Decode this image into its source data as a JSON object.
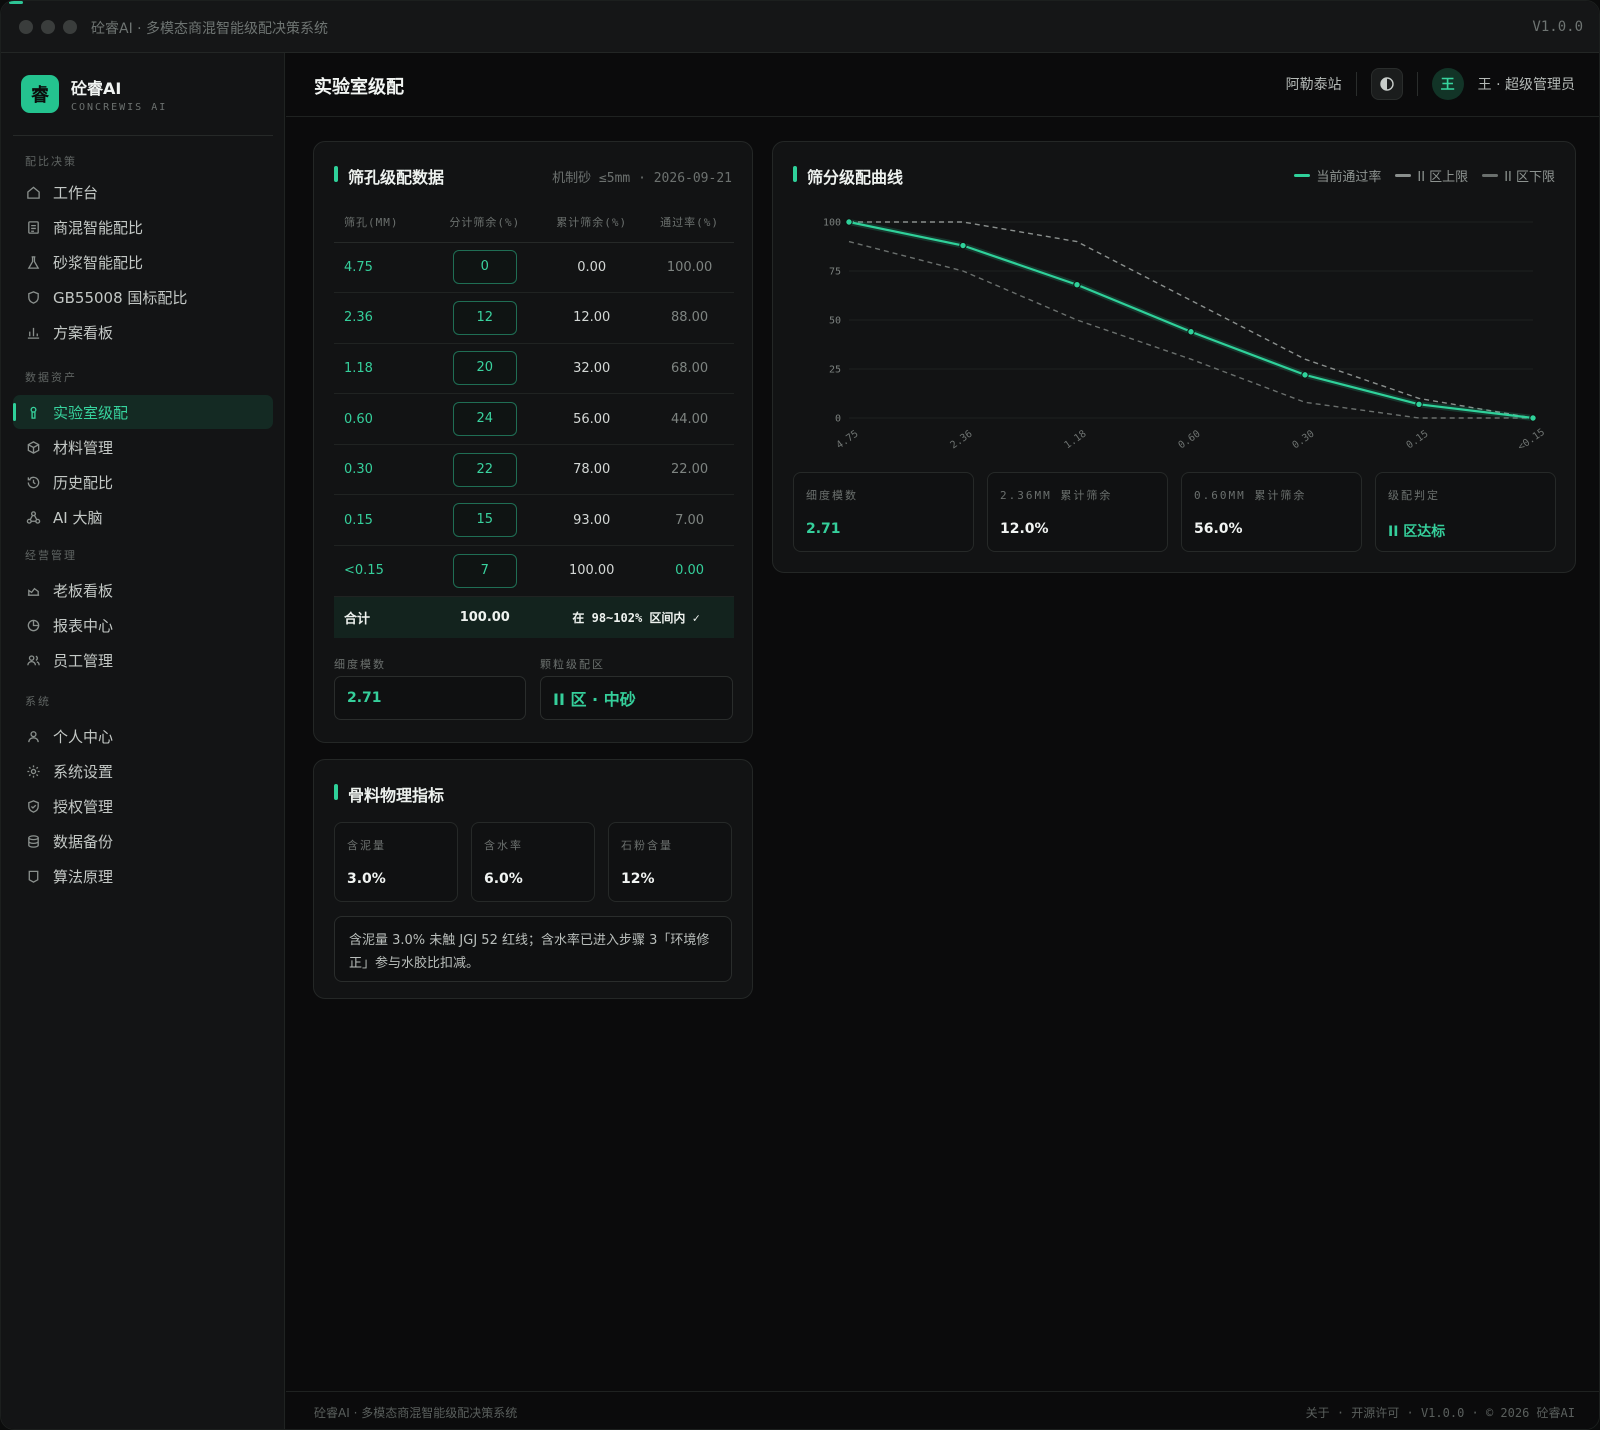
{
  "titlebar": {
    "title": "砼睿AI · 多模态商混智能级配决策系统",
    "version": "V1.0.0"
  },
  "brand": {
    "logo": "睿",
    "name": "砼睿AI",
    "sub": "CONCREWIS AI"
  },
  "nav": {
    "s1": "配比决策",
    "i1": "工作台",
    "i2": "商混智能配比",
    "i3": "砂浆智能配比",
    "i4": "GB55008 国标配比",
    "i5": "方案看板",
    "s2": "数据资产",
    "i6": "实验室级配",
    "i7": "材料管理",
    "i8": "历史配比",
    "i9": "AI 大脑",
    "s3": "经营管理",
    "i10": "老板看板",
    "i11": "报表中心",
    "i12": "员工管理",
    "s4": "系统",
    "i13": "个人中心",
    "i14": "系统设置",
    "i15": "授权管理",
    "i16": "数据备份",
    "i17": "算法原理"
  },
  "header": {
    "title": "实验室级配",
    "station": "阿勒泰站",
    "avatar": "王",
    "user": "王 · 超级管理员"
  },
  "sieve_card": {
    "title": "筛孔级配数据",
    "meta": "机制砂 ≤5mm · 2026-09-21",
    "columns": [
      "筛孔(MM)",
      "分计筛余(%)",
      "累计筛余(%)",
      "通过率(%)"
    ],
    "rows": [
      {
        "sieve": "4.75",
        "retained": "0",
        "cumulative": "0.00",
        "passing": "100.00"
      },
      {
        "sieve": "2.36",
        "retained": "12",
        "cumulative": "12.00",
        "passing": "88.00"
      },
      {
        "sieve": "1.18",
        "retained": "20",
        "cumulative": "32.00",
        "passing": "68.00"
      },
      {
        "sieve": "0.60",
        "retained": "24",
        "cumulative": "56.00",
        "passing": "44.00"
      },
      {
        "sieve": "0.30",
        "retained": "22",
        "cumulative": "78.00",
        "passing": "22.00"
      },
      {
        "sieve": "0.15",
        "retained": "15",
        "cumulative": "93.00",
        "passing": "7.00"
      },
      {
        "sieve": "<0.15",
        "retained": "7",
        "cumulative": "100.00",
        "passing": "0.00"
      }
    ],
    "total_label": "合计",
    "total_value": "100.00",
    "total_status": "在 98~102% 区间内 ✓",
    "fineness_label": "细度模数",
    "fineness_value": "2.71",
    "zone_label": "颗粒级配区",
    "zone_value": "II 区 · 中砂"
  },
  "phys_card": {
    "title": "骨料物理指标",
    "kpis": [
      {
        "label": "含泥量",
        "value": "3.0%"
      },
      {
        "label": "含水率",
        "value": "6.0%"
      },
      {
        "label": "石粉含量",
        "value": "12%"
      }
    ],
    "note": "含泥量 3.0% 未触 JGJ 52 红线；含水率已进入步骤 3「环境修正」参与水胶比扣减。"
  },
  "curve_card": {
    "title": "筛分级配曲线",
    "kpis": [
      {
        "label": "细度模数",
        "value": "2.71"
      },
      {
        "label": "2.36MM 累计筛余",
        "value": "12.0%"
      },
      {
        "label": "0.60MM 累计筛余",
        "value": "56.0%"
      },
      {
        "label": "级配判定",
        "value": "II 区达标"
      }
    ]
  },
  "colors": {
    "accent": "#2fd19a",
    "upper": "#8a8f8d",
    "lower": "#6a6f6d",
    "bg": "#0b0c0c"
  },
  "chart_data": {
    "type": "line",
    "x": [
      "4.75",
      "2.36",
      "1.18",
      "0.60",
      "0.30",
      "0.15",
      "<0.15"
    ],
    "ylim": [
      0,
      100
    ],
    "yticks": [
      0,
      25,
      50,
      75,
      100
    ],
    "grid": true,
    "legend_position": "top-right",
    "series": [
      {
        "name": "当前通过率",
        "values": [
          100,
          88,
          68,
          44,
          22,
          7,
          0
        ],
        "color": "#2fd19a",
        "style": "solid"
      },
      {
        "name": "II 区上限",
        "values": [
          100,
          100,
          90,
          60,
          30,
          10,
          0
        ],
        "color": "#8a8f8d",
        "style": "dashed"
      },
      {
        "name": "II 区下限",
        "values": [
          90,
          75,
          50,
          30,
          8,
          0,
          0
        ],
        "color": "#6a6f6d",
        "style": "dashed"
      }
    ]
  },
  "footer": {
    "left": "砼睿AI · 多模态商混智能级配决策系统",
    "right": "关于 · 开源许可 · V1.0.0 · © 2026 砼睿AI"
  }
}
